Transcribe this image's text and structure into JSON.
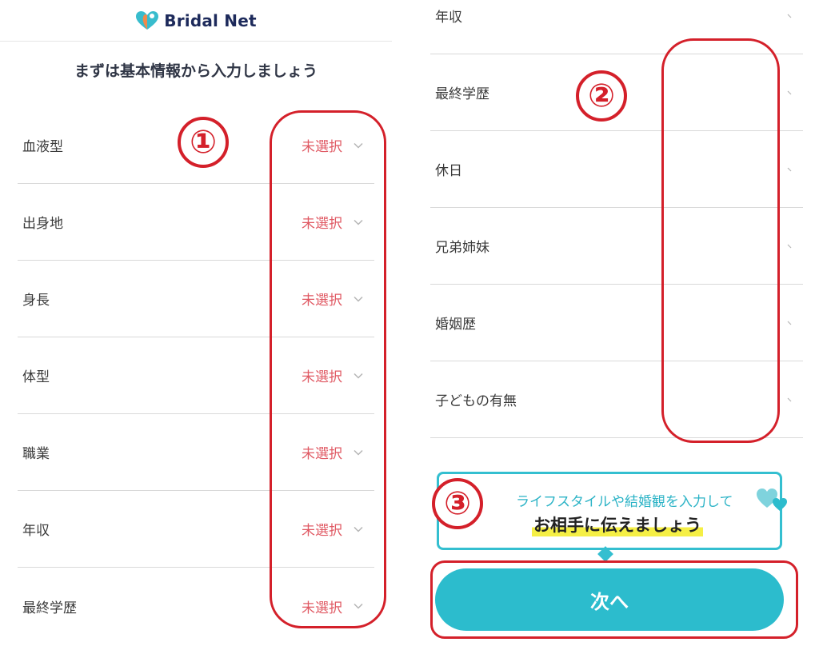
{
  "app": {
    "name": "Bridal Net"
  },
  "left": {
    "title": "まずは基本情報から入力しましょう",
    "unselected_label": "未選択",
    "fields": [
      {
        "label": "血液型",
        "value": "未選択"
      },
      {
        "label": "出身地",
        "value": "未選択"
      },
      {
        "label": "身長",
        "value": "未選択"
      },
      {
        "label": "体型",
        "value": "未選択"
      },
      {
        "label": "職業",
        "value": "未選択"
      },
      {
        "label": "年収",
        "value": "未選択"
      },
      {
        "label": "最終学歴",
        "value": "未選択"
      }
    ]
  },
  "right": {
    "fields": [
      {
        "label": "年収"
      },
      {
        "label": "最終学歴"
      },
      {
        "label": "休日"
      },
      {
        "label": "兄弟姉妹"
      },
      {
        "label": "婚姻歴"
      },
      {
        "label": "子どもの有無"
      }
    ],
    "tip": {
      "line1": "ライフスタイルや結婚観を入力して",
      "line2": "お相手に伝えましょう"
    },
    "next_button": "次へ"
  },
  "annotations": {
    "marker1": "①",
    "marker2": "②",
    "marker3": "③"
  },
  "colors": {
    "accent": "#2cbccd",
    "unselected": "#e05a64",
    "annotation": "#d4202a",
    "highlight": "#f5ef45"
  },
  "icons": {
    "chevron": "chevron-down-icon",
    "logo": "heart-logo-icon",
    "tip": "hearts-icon"
  }
}
